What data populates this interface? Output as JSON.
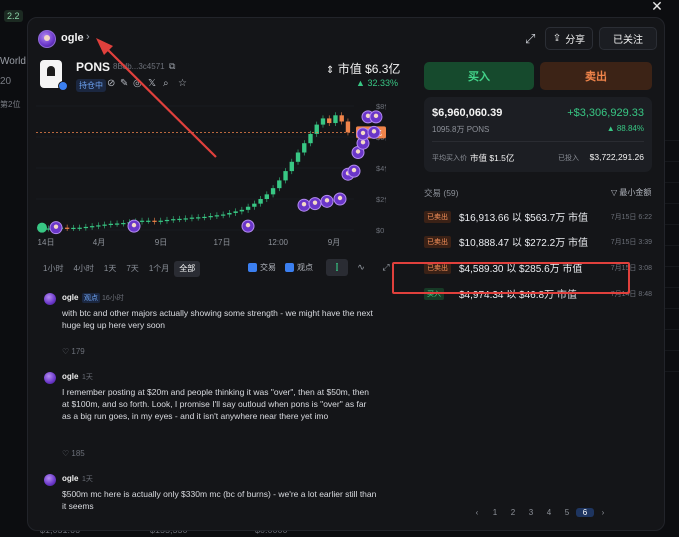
{
  "background": {
    "tag": "2.2",
    "left_texts": [
      "World L",
      "20",
      "第2位"
    ],
    "bottom_texts": [
      "$1,051.66",
      "$155,550",
      "$0.0000"
    ]
  },
  "header": {
    "username": "ogle",
    "share_label": "分享",
    "follow_label": "已关注"
  },
  "token": {
    "name": "PONS",
    "address": "8Bdb...3c4571",
    "holding_tag": "持仓中",
    "mcap": "市值 $6.3亿",
    "change": "32.33%"
  },
  "chart": {
    "price_label": "$6.3亿"
  },
  "chart_data": {
    "type": "line",
    "x_ticks": [
      "14日",
      "4月",
      "9日",
      "17日",
      "12:00",
      "9月"
    ],
    "y_ticks": [
      "$8亿",
      "$6亿",
      "$4亿",
      "$2亿",
      "$0"
    ],
    "ylim": [
      0,
      8
    ],
    "series": [
      {
        "values": [
          0.1,
          0.1,
          0.12,
          0.15,
          0.13,
          0.14,
          0.15,
          0.2,
          0.25,
          0.3,
          0.35,
          0.4,
          0.42,
          0.45,
          0.5,
          0.55,
          0.6,
          0.6,
          0.55,
          0.6,
          0.65,
          0.7,
          0.72,
          0.75,
          0.8,
          0.82,
          0.85,
          0.9,
          0.95,
          1.0,
          1.1,
          1.2,
          1.3,
          1.5,
          1.7,
          2.0,
          2.3,
          2.7,
          3.2,
          3.8,
          4.4,
          5.0,
          5.6,
          6.2,
          6.8,
          7.2,
          6.9,
          7.4,
          7.0,
          6.3
        ]
      }
    ]
  },
  "timeframes": {
    "items": [
      "1小时",
      "4小时",
      "1天",
      "7天",
      "1个月",
      "全部"
    ],
    "active": "全部"
  },
  "chart_options": {
    "trades": "交易",
    "views": "观点"
  },
  "comments": [
    {
      "user": "ogle",
      "tag": "观点",
      "time": "16小时",
      "text": "with btc and other majors actually showing some strength - we might have the next huge leg up here very soon",
      "likes": "179"
    },
    {
      "user": "ogle",
      "tag": "",
      "time": "1天",
      "text": "I remember posting at $20m and people thinking it was \"over\", then at $50m, then at $100m, and so forth. Look, I promise I'll say outloud when pons is \"over\" as far as a big run goes, in my eyes - and it isn't anywhere near there yet imo",
      "likes": "185"
    },
    {
      "user": "ogle",
      "tag": "",
      "time": "1天",
      "text": "$500m mc here is actually only $330m mc (bc of burns) - we're a lot earlier still than it seems",
      "likes": ""
    }
  ],
  "trade": {
    "buy_label": "买入",
    "sell_label": "卖出"
  },
  "position": {
    "value": "$6,960,060.39",
    "pnl": "+$3,306,929.33",
    "amount": "1095.8万 PONS",
    "pnl_pct": "88.84%",
    "avg_label": "平均买入价",
    "avg_value": "市值 $1.5亿",
    "invested_label": "已投入",
    "invested_value": "$3,722,291.26"
  },
  "transactions": {
    "title": "交易 (59)",
    "filter": "最小金额",
    "rows": [
      {
        "type": "sell",
        "badge": "已卖出",
        "text": "$16,913.66 以 $563.7万 市值",
        "date": "7月15日 6:22"
      },
      {
        "type": "sell",
        "badge": "已卖出",
        "text": "$10,888.47 以 $272.2万 市值",
        "date": "7月15日 3:39"
      },
      {
        "type": "sell",
        "badge": "已卖出",
        "text": "$4,589.30 以 $285.6万 市值",
        "date": "7月15日 3:08"
      },
      {
        "type": "buy",
        "badge": "买入",
        "text": "$4,974.34 以 $46.8万 市值",
        "date": "7月14日 8:48"
      }
    ]
  },
  "pagination": {
    "pages": [
      "1",
      "2",
      "3",
      "4",
      "5",
      "6"
    ],
    "current": "6"
  },
  "colors": {
    "up": "#38c784",
    "down": "#f0844a",
    "accent": "#3b7ff0",
    "annotation": "#e0403c"
  }
}
